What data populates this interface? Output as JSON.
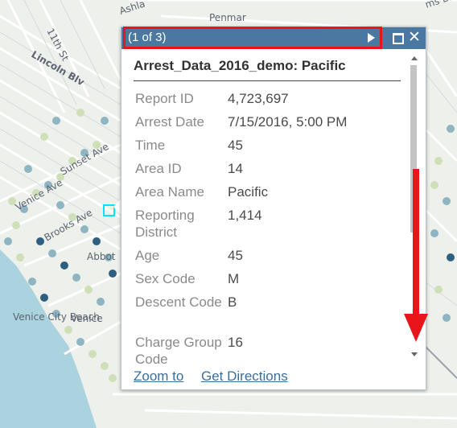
{
  "map": {
    "street_labels": [
      "Ashla",
      "Penmar",
      "11th St",
      "Lincoln Blv",
      "Sunset Ave",
      "Venice Ave",
      "Brooks Ave",
      "Abbot",
      "Venice",
      "Venice City Beach",
      "ms Blvd"
    ],
    "colors": {
      "water": "#aad3df",
      "land": "#eef0ec",
      "road": "#ffffff",
      "point_light": "#cfe0b8",
      "point_mid": "#8fb4c2",
      "point_dark": "#2f5f7f",
      "selection": "#00e5ff"
    }
  },
  "popup": {
    "pager": "(1 of 3)",
    "title": "Arrest_Data_2016_demo: Pacific",
    "attributes": [
      {
        "label": "Report ID",
        "value": "4,723,697"
      },
      {
        "label": "Arrest Date",
        "value": "7/15/2016, 5:00 PM"
      },
      {
        "label": "Time",
        "value": "45"
      },
      {
        "label": "Area ID",
        "value": "14"
      },
      {
        "label": "Area Name",
        "value": "Pacific"
      },
      {
        "label": "Reporting District",
        "value": "1,414"
      },
      {
        "label": "Age",
        "value": "45"
      },
      {
        "label": "Sex Code",
        "value": "M"
      },
      {
        "label": "Descent Code",
        "value": "B"
      },
      {
        "label": "Charge Group Code",
        "value": "16"
      }
    ],
    "links": {
      "zoom": "Zoom to",
      "directions": "Get Directions"
    },
    "icons": {
      "next": "next-arrow-icon",
      "maximize": "maximize-icon",
      "close": "close-icon"
    },
    "header_color": "#4a78a0"
  },
  "annotation": {
    "color": "#e8161b",
    "arrow_direction": "down"
  }
}
